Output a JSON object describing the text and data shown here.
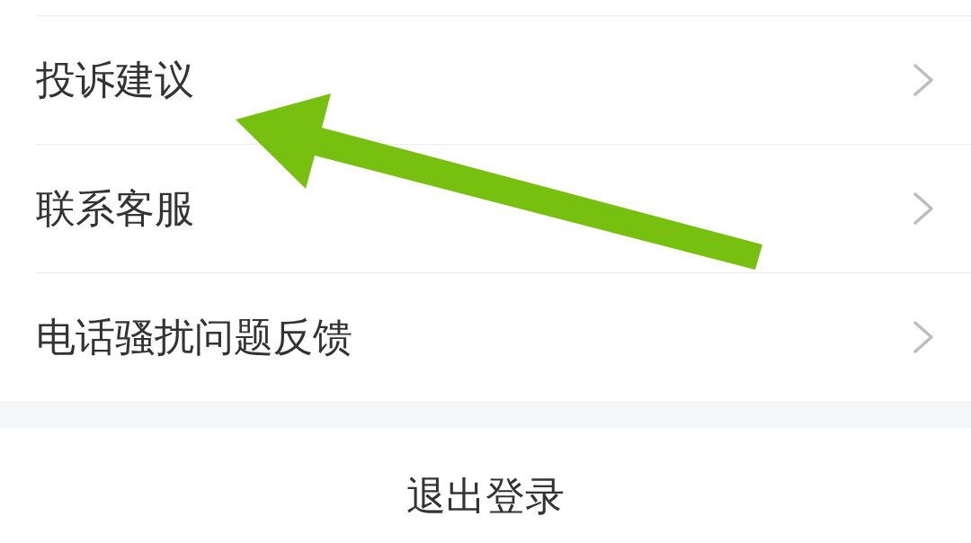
{
  "menu_items": [
    {
      "label": "投诉建议"
    },
    {
      "label": "联系客服"
    },
    {
      "label": "电话骚扰问题反馈"
    }
  ],
  "logout_button": {
    "label": "退出登录"
  }
}
